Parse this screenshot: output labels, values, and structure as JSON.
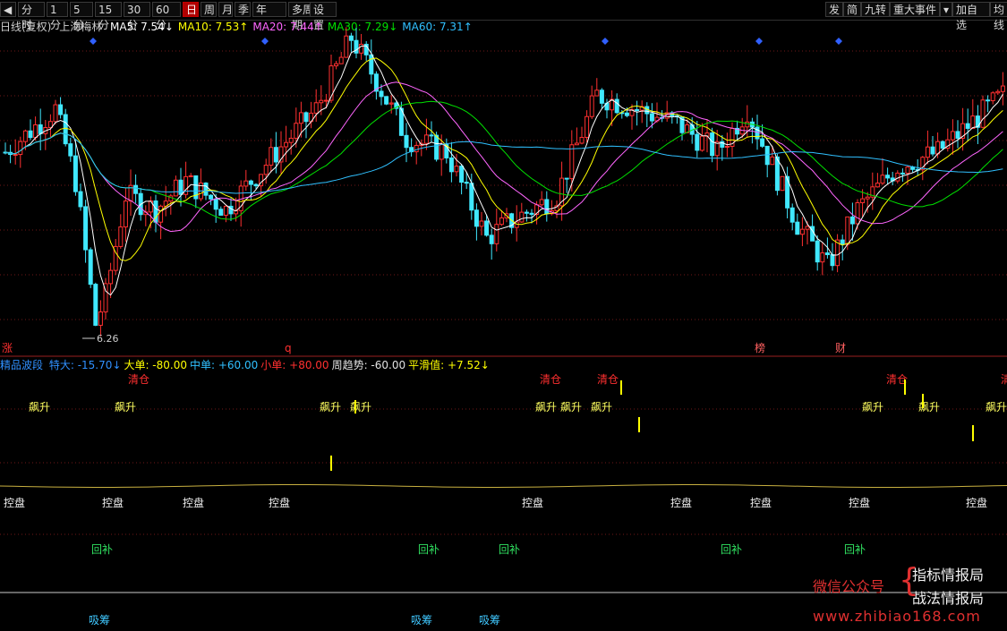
{
  "toolbar": {
    "nav_icon": "step-back-icon",
    "periods": [
      {
        "label": "分时",
        "active": false
      },
      {
        "label": "1分",
        "active": false
      },
      {
        "label": "5分",
        "active": false
      },
      {
        "label": "15分",
        "active": false
      },
      {
        "label": "30分",
        "active": false
      },
      {
        "label": "60分",
        "active": false
      },
      {
        "label": "日",
        "active": true
      },
      {
        "label": "周",
        "active": false
      },
      {
        "label": "月",
        "active": false
      },
      {
        "label": "季",
        "active": false
      },
      {
        "label": "年",
        "active": false
      },
      {
        "label": "多周期",
        "active": false
      },
      {
        "label": "设置",
        "active": false
      }
    ],
    "right": [
      "发",
      "简",
      "九转",
      "重大事件",
      "加自选",
      "均线"
    ],
    "dropdown_icon": "caret-down-icon"
  },
  "info": {
    "period": "日线(复权)",
    "stock": "上海梅林",
    "ma": [
      {
        "label": "MA5: 7.54↓",
        "color": "#ffffff"
      },
      {
        "label": "MA10: 7.53↑",
        "color": "#ffff00"
      },
      {
        "label": "MA20: 7.44↑",
        "color": "#ff66ff"
      },
      {
        "label": "MA30: 7.29↓",
        "color": "#00e000"
      },
      {
        "label": "MA60: 7.31↑",
        "color": "#30c0ff"
      }
    ]
  },
  "indicator": {
    "name": "精品波段",
    "items": [
      {
        "label": "特大: -15.70↓",
        "color": "#3090ff"
      },
      {
        "label": "大单: -80.00",
        "color": "#ffff00"
      },
      {
        "label": "中单: +60.00",
        "color": "#30c0ff"
      },
      {
        "label": "小单: +80.00",
        "color": "#ff3030"
      },
      {
        "label": "周趋势: -60.00",
        "color": "#e0e0e0"
      },
      {
        "label": "平滑值: +7.52↓",
        "color": "#ffff00"
      }
    ]
  },
  "chart_data": {
    "type": "candlestick",
    "price_low_label": "6.26",
    "ma_names": [
      "MA5",
      "MA10",
      "MA20",
      "MA30",
      "MA60"
    ],
    "events": [
      "涨",
      "q",
      "榜",
      "财"
    ],
    "signals": {
      "qingcang": "清仓",
      "piaosheng": "飙升",
      "kongpan": "控盘",
      "huibu": "回补",
      "xichou": "吸筹"
    }
  },
  "watermark": {
    "left": "微信公众号",
    "brace": "{",
    "right1": "指标情报局",
    "right2": "战法情报局",
    "url": "www.zhibiao168.com"
  }
}
